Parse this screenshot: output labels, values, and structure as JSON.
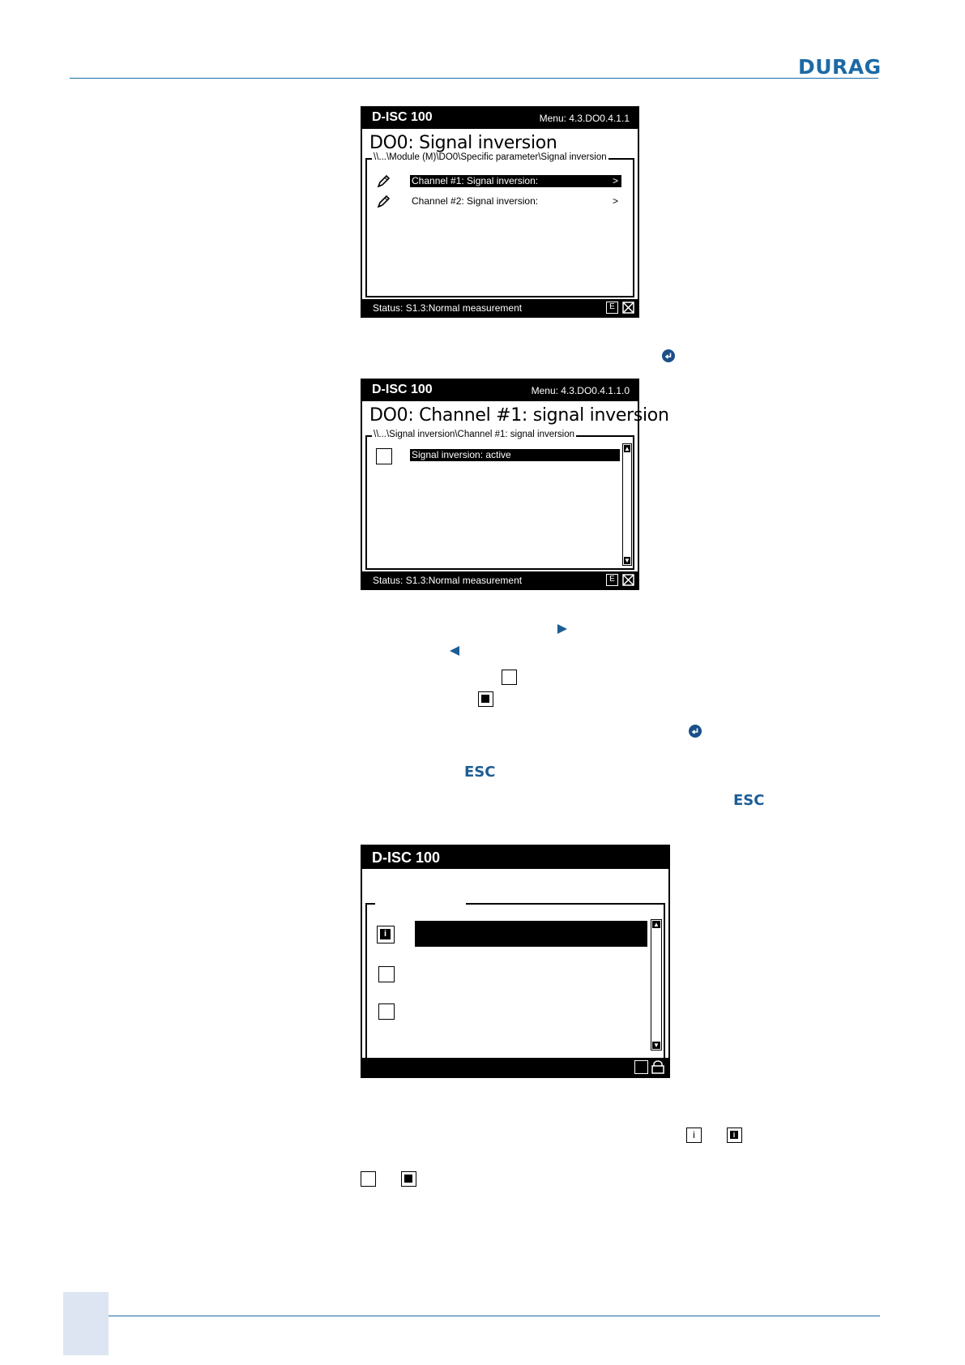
{
  "header": {
    "logo": "DURAG"
  },
  "screen1": {
    "device": "D-ISC 100",
    "menu": "Menu: 4.3.DO0.4.1.1",
    "heading": "DO0: Signal inversion",
    "path": "\\\\...\\Module (M)\\DO0\\Specific parameter\\Signal inversion",
    "rows": [
      {
        "label": "Channel #1: Signal inversion:",
        "chevron": ">",
        "icon": "pencil-icon",
        "selected": true
      },
      {
        "label": "Channel #2: Signal inversion:",
        "chevron": ">",
        "icon": "pencil-icon",
        "selected": false
      }
    ],
    "status": "Status: S1.3:Normal measurement",
    "status_icon_e": "E"
  },
  "screen2": {
    "device": "D-ISC 100",
    "menu": "Menu: 4.3.DO0.4.1.1.0",
    "heading": "DO0: Channel #1: signal inversion",
    "path": "\\\\...\\Signal inversion\\Channel #1: signal inversion",
    "rows": [
      {
        "label": "Signal inversion: active",
        "icon": "checkbox-empty-icon",
        "selected": true
      }
    ],
    "status": "Status: S1.3:Normal measurement",
    "status_icon_e": "E"
  },
  "screen3": {
    "device": "D-ISC 100"
  },
  "inline_icons": {
    "esc_label": "ESC",
    "colors": {
      "accent": "#1c6aa6",
      "enter": "#1a4f8a",
      "arrow": "#1c5d94"
    }
  }
}
